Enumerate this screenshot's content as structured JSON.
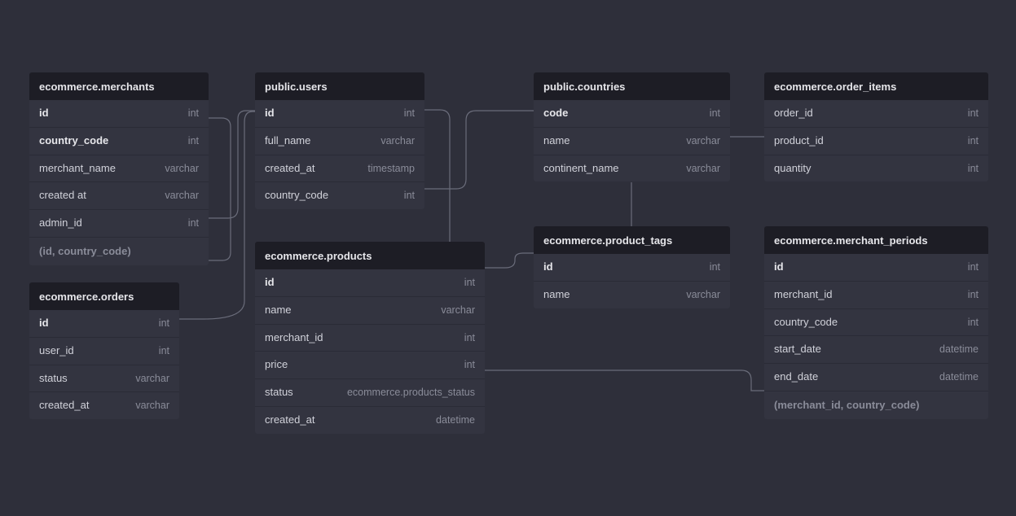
{
  "tables": {
    "merchants": {
      "title": "ecommerce.merchants",
      "cols": [
        {
          "name": "id",
          "type": "int",
          "bold": true
        },
        {
          "name": "country_code",
          "type": "int",
          "bold": true
        },
        {
          "name": "merchant_name",
          "type": "varchar"
        },
        {
          "name": "created at",
          "type": "varchar"
        },
        {
          "name": "admin_id",
          "type": "int"
        }
      ],
      "composite": "(id, country_code)"
    },
    "users": {
      "title": "public.users",
      "cols": [
        {
          "name": "id",
          "type": "int",
          "bold": true
        },
        {
          "name": "full_name",
          "type": "varchar"
        },
        {
          "name": "created_at",
          "type": "timestamp"
        },
        {
          "name": "country_code",
          "type": "int"
        }
      ]
    },
    "countries": {
      "title": "public.countries",
      "cols": [
        {
          "name": "code",
          "type": "int",
          "bold": true
        },
        {
          "name": "name",
          "type": "varchar"
        },
        {
          "name": "continent_name",
          "type": "varchar"
        }
      ]
    },
    "order_items": {
      "title": "ecommerce.order_items",
      "cols": [
        {
          "name": "order_id",
          "type": "int"
        },
        {
          "name": "product_id",
          "type": "int"
        },
        {
          "name": "quantity",
          "type": "int"
        }
      ]
    },
    "product_tags": {
      "title": "ecommerce.product_tags",
      "cols": [
        {
          "name": "id",
          "type": "int",
          "bold": true
        },
        {
          "name": "name",
          "type": "varchar"
        }
      ]
    },
    "merchant_periods": {
      "title": "ecommerce.merchant_periods",
      "cols": [
        {
          "name": "id",
          "type": "int",
          "bold": true
        },
        {
          "name": "merchant_id",
          "type": "int"
        },
        {
          "name": "country_code",
          "type": "int"
        },
        {
          "name": "start_date",
          "type": "datetime"
        },
        {
          "name": "end_date",
          "type": "datetime"
        }
      ],
      "composite": "(merchant_id, country_code)"
    },
    "orders": {
      "title": "ecommerce.orders",
      "cols": [
        {
          "name": "id",
          "type": "int",
          "bold": true
        },
        {
          "name": "user_id",
          "type": "int"
        },
        {
          "name": "status",
          "type": "varchar"
        },
        {
          "name": "created_at",
          "type": "varchar"
        }
      ]
    },
    "products": {
      "title": "ecommerce.products",
      "cols": [
        {
          "name": "id",
          "type": "int",
          "bold": true
        },
        {
          "name": "name",
          "type": "varchar"
        },
        {
          "name": "merchant_id",
          "type": "int"
        },
        {
          "name": "price",
          "type": "int"
        },
        {
          "name": "status",
          "type": "ecommerce.products_status"
        },
        {
          "name": "created_at",
          "type": "datetime"
        }
      ]
    }
  }
}
